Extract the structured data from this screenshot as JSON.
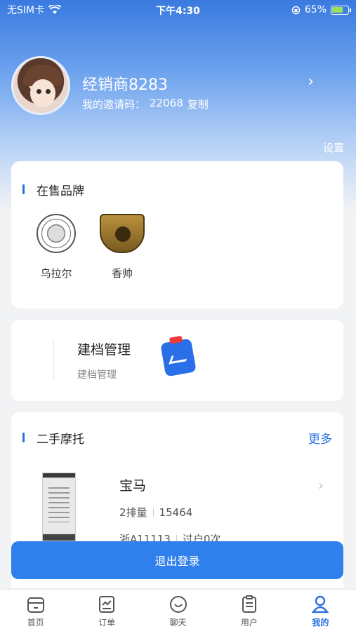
{
  "status_bar": {
    "carrier": "无SIM卡",
    "time": "下午4:30",
    "battery": "65%"
  },
  "profile": {
    "name": "经销商8283",
    "invite_label": "我的邀请码：",
    "invite_code": "22068",
    "copy_label": "复制",
    "settings_label": "设置"
  },
  "brands": {
    "title": "在售品牌",
    "items": [
      {
        "name": "乌拉尔"
      },
      {
        "name": "香帅"
      }
    ]
  },
  "archive": {
    "title": "建档管理",
    "subtitle": "建档管理"
  },
  "used_moto": {
    "title": "二手摩托",
    "more_label": "更多",
    "items": [
      {
        "model": "宝马",
        "displacement": "2排量",
        "mileage": "15464",
        "plate": "浙A11113",
        "transfers": "过户0次"
      }
    ]
  },
  "logout_label": "退出登录",
  "tabs": [
    {
      "label": "首页",
      "icon": "home-icon",
      "active": false
    },
    {
      "label": "订单",
      "icon": "order-icon",
      "active": false
    },
    {
      "label": "聊天",
      "icon": "chat-icon",
      "active": false
    },
    {
      "label": "用户",
      "icon": "user-list-icon",
      "active": false
    },
    {
      "label": "我的",
      "icon": "profile-icon",
      "active": true
    }
  ],
  "colors": {
    "accent": "#2f80ed",
    "header_top": "#3a7ae0"
  }
}
